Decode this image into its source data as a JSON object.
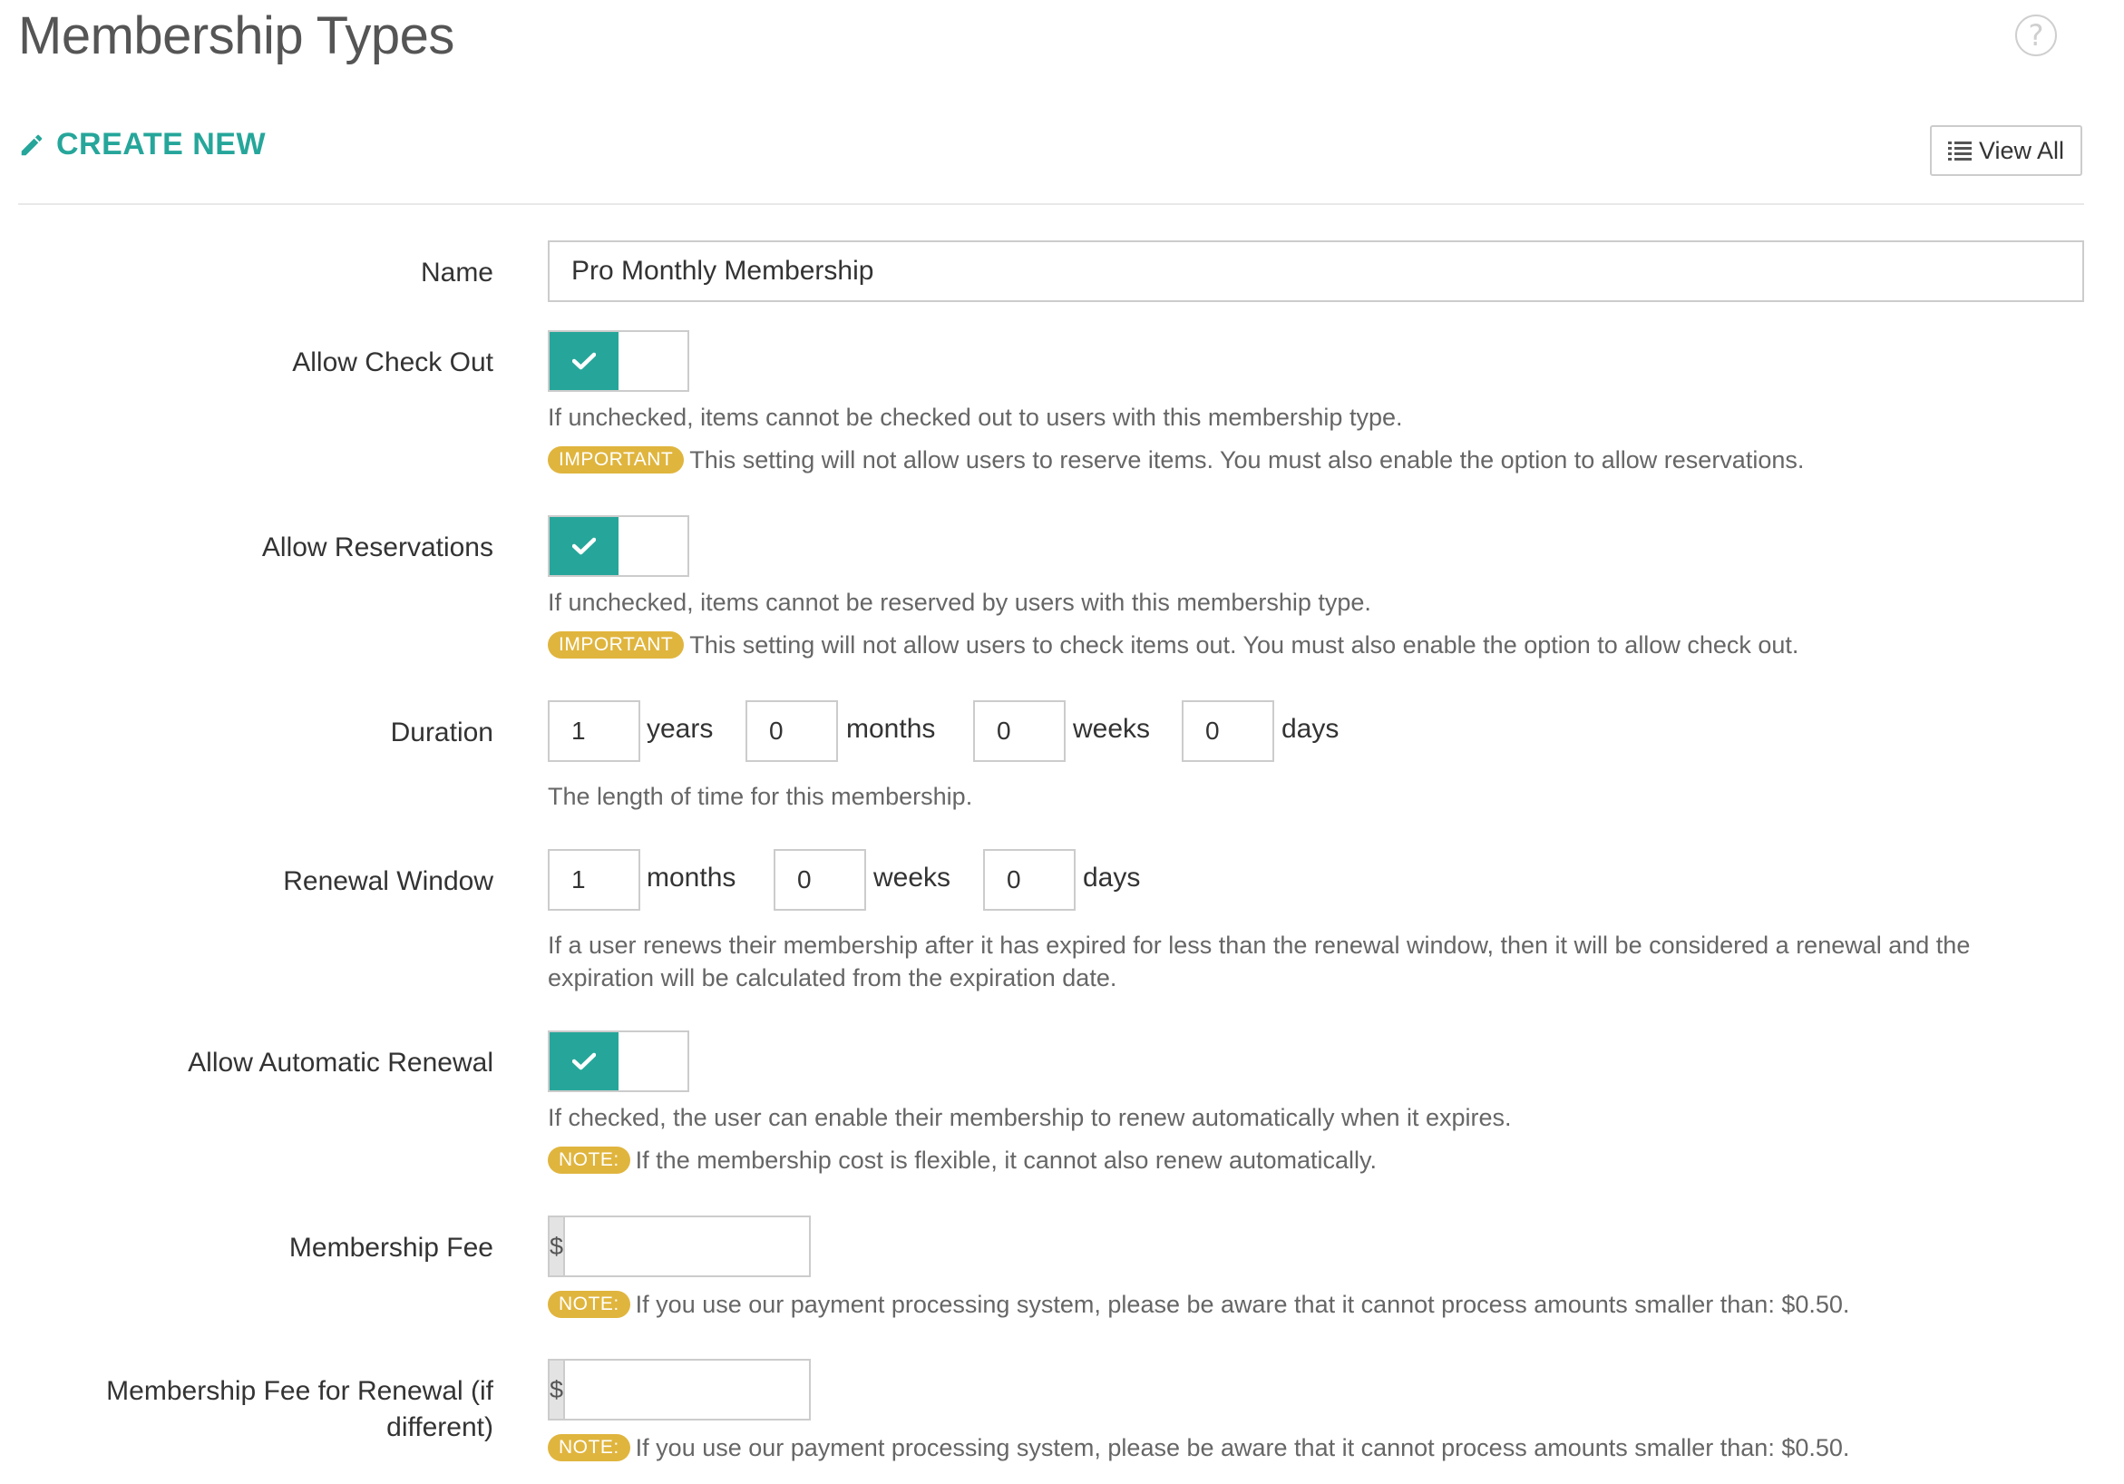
{
  "page": {
    "title": "Membership Types",
    "help_icon": "question-circle-icon"
  },
  "header": {
    "create_label": "CREATE NEW",
    "create_icon": "pencil-icon",
    "view_all_label": "View All",
    "view_all_icon": "list-icon"
  },
  "colors": {
    "accent": "#26a69a",
    "badge": "#e0b53e"
  },
  "form": {
    "name": {
      "label": "Name",
      "value": "Pro Monthly Membership"
    },
    "allow_check_out": {
      "label": "Allow Check Out",
      "checked": true,
      "help": "If unchecked, items cannot be checked out to users with this membership type.",
      "badge": "IMPORTANT",
      "note": "This setting will not allow users to reserve items. You must also enable the option to allow reservations."
    },
    "allow_reservations": {
      "label": "Allow Reservations",
      "checked": true,
      "help": "If unchecked, items cannot be reserved by users with this membership type.",
      "badge": "IMPORTANT",
      "note": "This setting will not allow users to check items out. You must also enable the option to allow check out."
    },
    "duration": {
      "label": "Duration",
      "years": "1",
      "years_unit": "years",
      "months": "0",
      "months_unit": "months",
      "weeks": "0",
      "weeks_unit": "weeks",
      "days": "0",
      "days_unit": "days",
      "help": "The length of time for this membership."
    },
    "renewal_window": {
      "label": "Renewal Window",
      "months": "1",
      "months_unit": "months",
      "weeks": "0",
      "weeks_unit": "weeks",
      "days": "0",
      "days_unit": "days",
      "help": "If a user renews their membership after it has expired for less than the renewal window, then it will be considered a renewal and the expiration will be calculated from the expiration date."
    },
    "allow_auto_renewal": {
      "label": "Allow Automatic Renewal",
      "checked": true,
      "help": "If checked, the user can enable their membership to renew automatically when it expires.",
      "badge": "NOTE:",
      "note": "If the membership cost is flexible, it cannot also renew automatically."
    },
    "membership_fee": {
      "label": "Membership Fee",
      "currency": "$",
      "value": "",
      "badge": "NOTE:",
      "note": "If you use our payment processing system, please be aware that it cannot process amounts smaller than: $0.50."
    },
    "renewal_fee": {
      "label": "Membership Fee for Renewal (if different)",
      "currency": "$",
      "value": "",
      "badge": "NOTE:",
      "note": "If you use our payment processing system, please be aware that it cannot process amounts smaller than: $0.50."
    }
  }
}
